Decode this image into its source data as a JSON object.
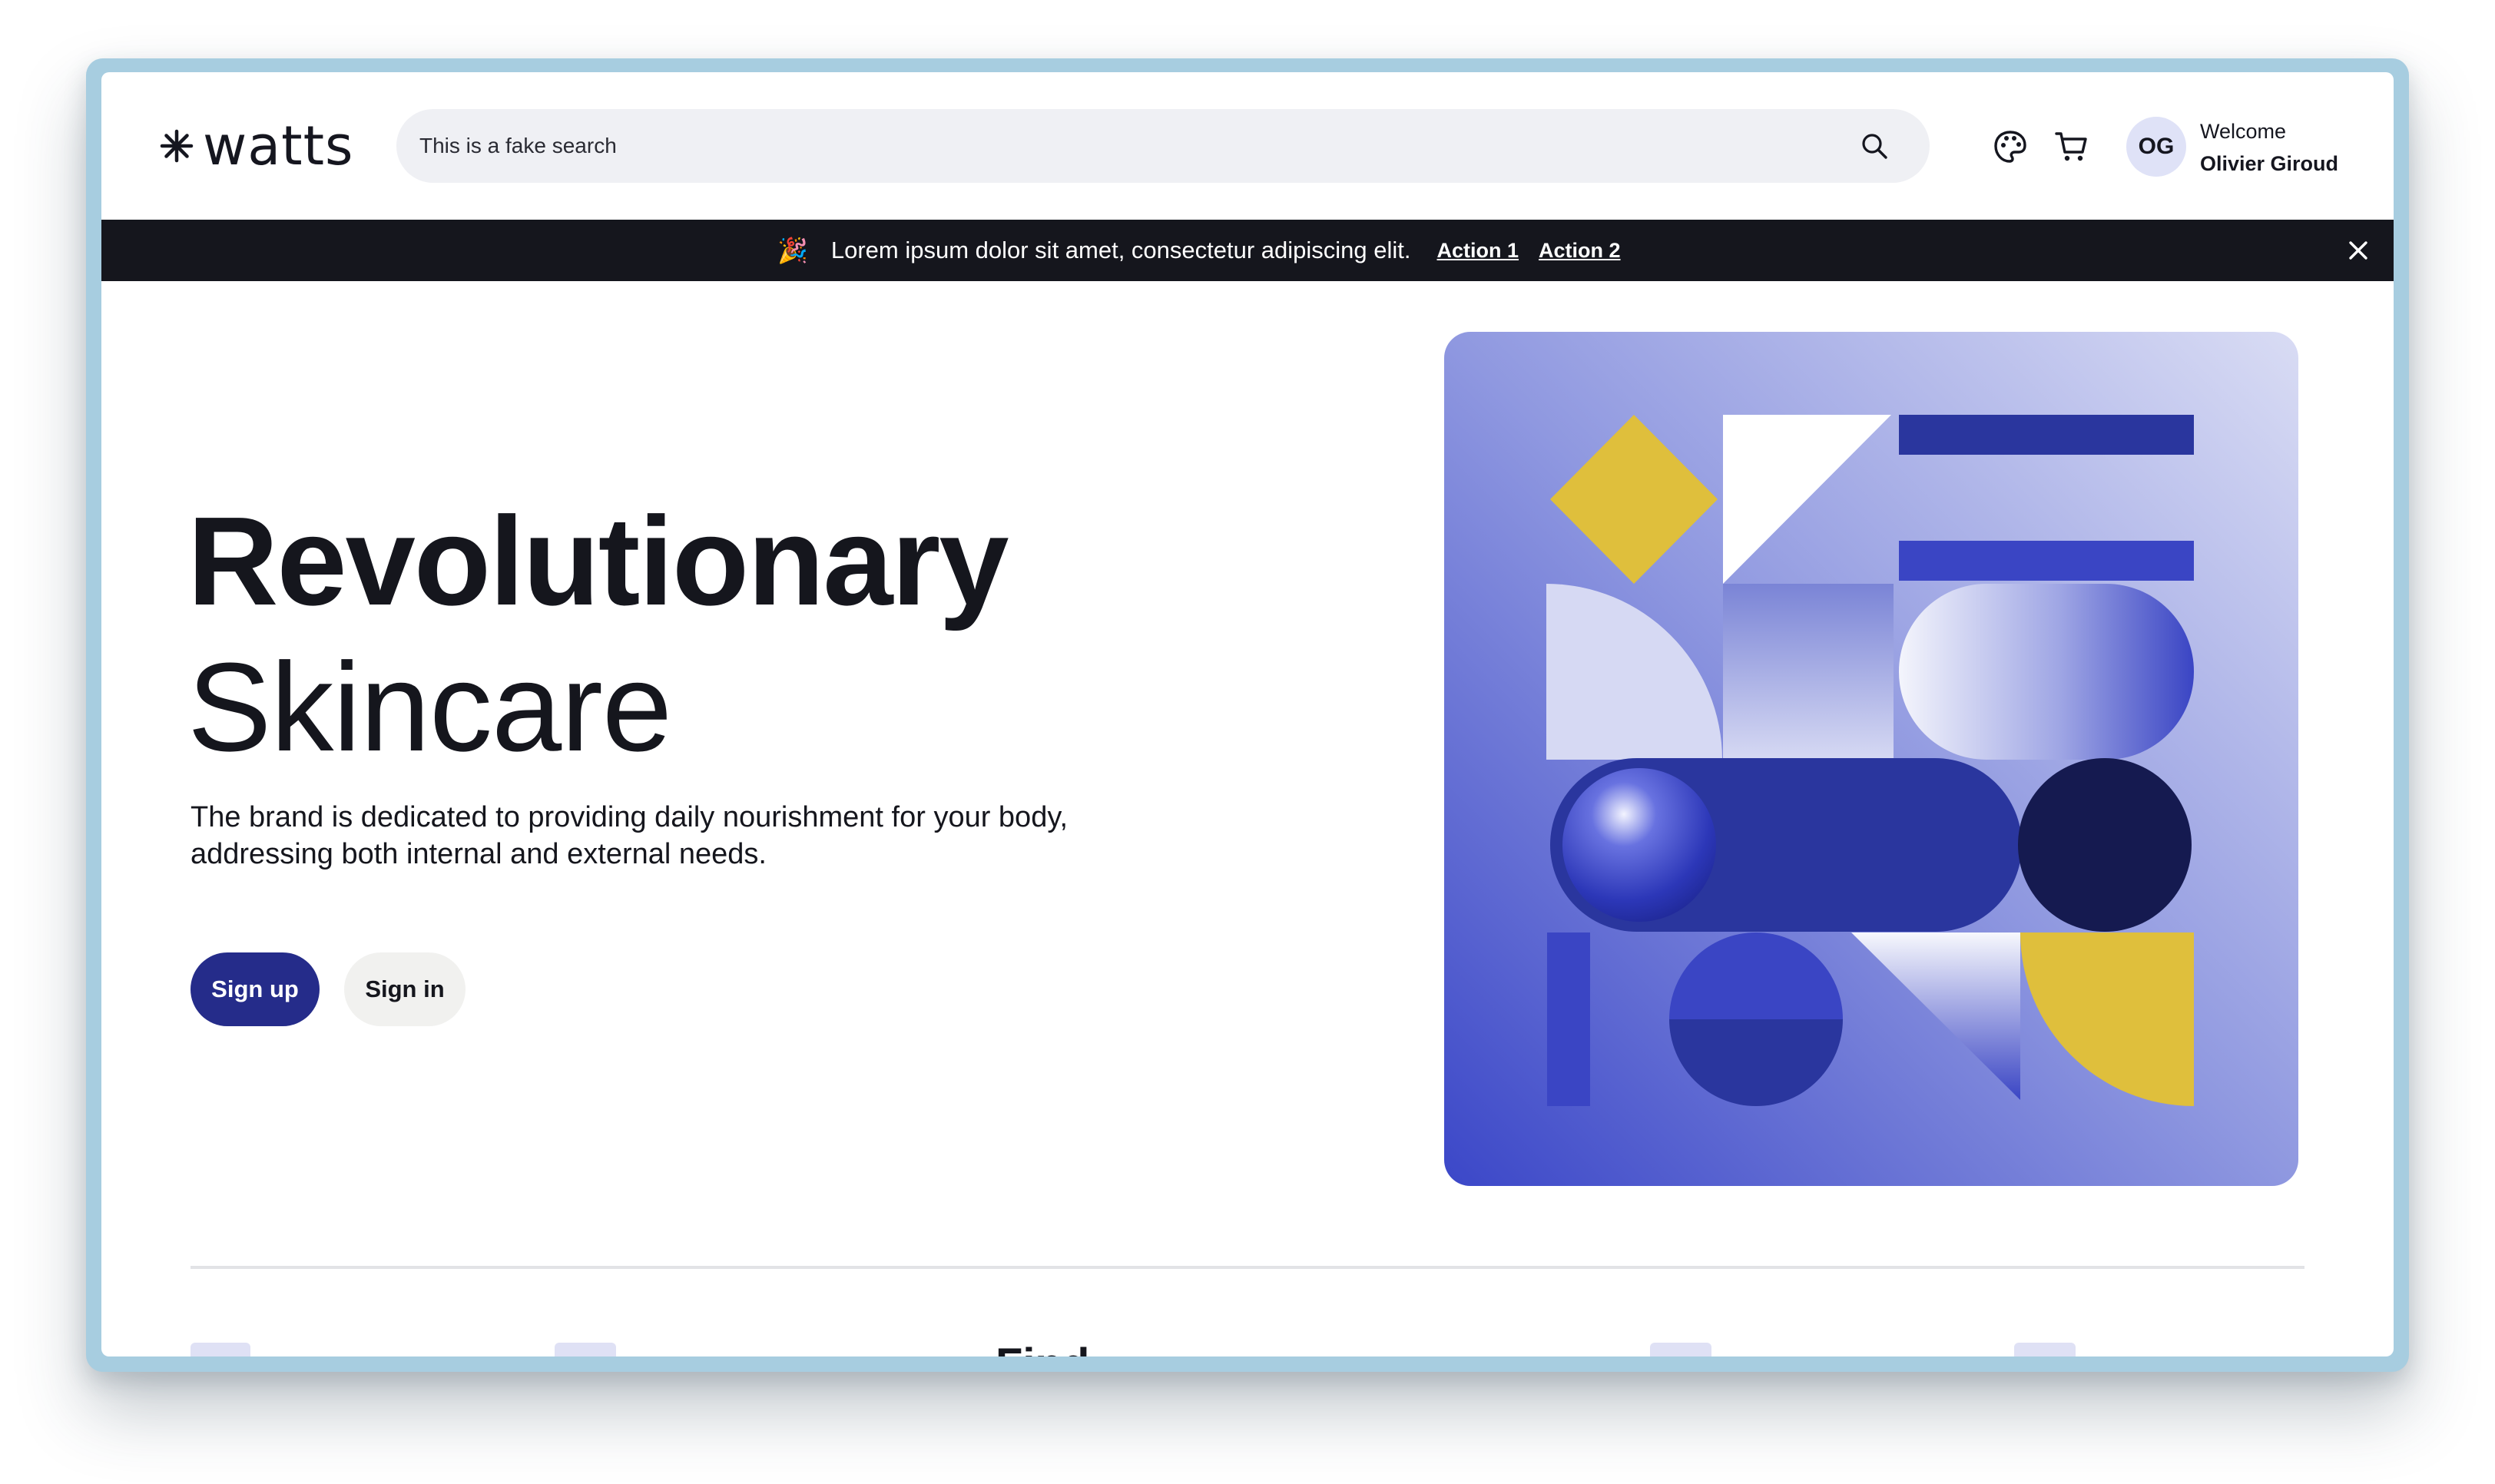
{
  "header": {
    "logo_text": "watts",
    "search": {
      "placeholder": "This is a fake search"
    },
    "user": {
      "initials": "OG",
      "greeting": "Welcome",
      "name": "Olivier Giroud"
    }
  },
  "banner": {
    "emoji": "🎉",
    "message": "Lorem ipsum dolor sit amet, consectetur adipiscing elit.",
    "action1": "Action 1",
    "action2": "Action 2"
  },
  "hero": {
    "title_bold": "Revolutionary",
    "title_light": "Skincare",
    "description": "The brand is dedicated to providing daily nourishment for your body, addressing both internal and external needs.",
    "signup_label": "Sign up",
    "signin_label": "Sign in"
  },
  "next_section": {
    "title_peek": "Find the"
  },
  "colors": {
    "primary": "#252c8a",
    "banner_bg": "#15161d",
    "accent_yellow": "#dfbf3c",
    "art_blue": "#3a45c4",
    "art_navy": "#151a50"
  }
}
